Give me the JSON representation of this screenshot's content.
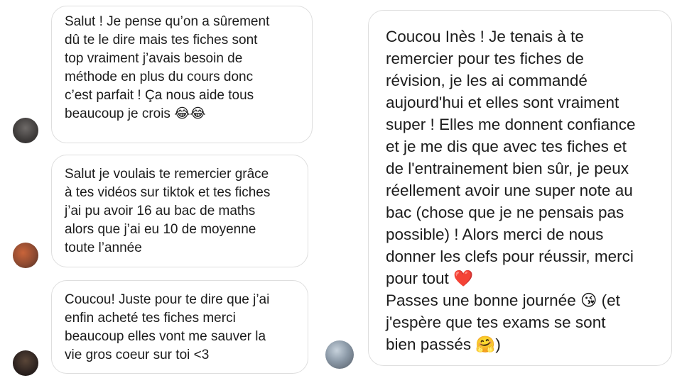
{
  "messages": [
    {
      "text": "Salut ! Je pense qu’on a sûrement\ndû te le dire mais tes fiches sont\ntop vraiment j’avais besoin de\nméthode en plus du cours donc\nc’est parfait ! Ça nous aide tous\nbeaucoup je crois 😂😂"
    },
    {
      "text": "Salut je voulais te remercier grâce\nà tes vidéos sur tiktok et tes fiches\nj’ai pu avoir 16 au bac de maths\nalors que j’ai eu 10 de moyenne\ntoute l’année"
    },
    {
      "text": "Coucou! Juste pour te dire que j’ai\nenfin acheté tes fiches merci\nbeaucoup elles vont me sauver la\nvie gros coeur sur toi <3"
    },
    {
      "text": "Coucou Inès ! Je tenais à te\nremercier pour tes fiches de\nrévision, je les ai commandé\naujourd'hui et elles sont vraiment\nsuper ! Elles me donnent confiance\net je me dis que avec tes fiches et\nde l'entrainement bien sûr, je peux\nréellement avoir une super note au\nbac (chose que je ne pensais pas\npossible) ! Alors merci de nous\ndonner les clefs pour réussir, merci\npour tout ❤️\nPasses une bonne journée 😘 (et\nj'espère que tes exams se sont\nbien passés 🤗)"
    }
  ]
}
